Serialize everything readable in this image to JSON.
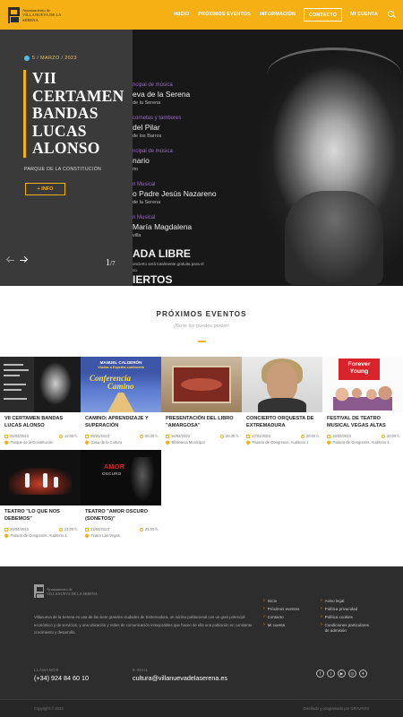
{
  "header": {
    "logo_line1": "Ayuntamiento de",
    "logo_line2": "VILLANUEVA DE LA SERENA",
    "nav": [
      "INICIO",
      "PRÓXIMOS EVENTOS",
      "INFORMACIÓN",
      "CONTACTO",
      "MI CUENTA"
    ],
    "accent": "#f5b014"
  },
  "hero": {
    "date": "5 / MARZO / 2023",
    "title": "VII CERTAMEN BANDAS LUCAS ALONSO",
    "place": "PARQUE DE LA CONSTITUCIÓN",
    "button": "+ INFO",
    "counter_current": "1",
    "counter_total": "/7",
    "poster_lines": [
      {
        "t": "ncipal de música",
        "s": "small"
      },
      {
        "t": "eva de la Serena",
        "s": "big"
      },
      {
        "t": "de la Serena",
        "s": "sub"
      },
      {
        "t": "",
        "s": "gap"
      },
      {
        "t": "cornetas y tambores",
        "s": "small"
      },
      {
        "t": "del Pilar",
        "s": "big"
      },
      {
        "t": "de los Barros",
        "s": "sub"
      },
      {
        "t": "",
        "s": "gap"
      },
      {
        "t": "ncipal de música",
        "s": "small"
      },
      {
        "t": "nario",
        "s": "big"
      },
      {
        "t": "rio",
        "s": "sub"
      },
      {
        "t": "",
        "s": "gap"
      },
      {
        "t": "n Musical",
        "s": "small"
      },
      {
        "t": "o Padre Jesús Nazareno",
        "s": "big"
      },
      {
        "t": "de la Serena",
        "s": "sub"
      },
      {
        "t": "",
        "s": "gap"
      },
      {
        "t": "n Musical",
        "s": "small"
      },
      {
        "t": "María Magdalena",
        "s": "big"
      },
      {
        "t": "villa",
        "s": "sub"
      },
      {
        "t": "",
        "s": "gap"
      },
      {
        "t": "ADA LIBRE",
        "s": "xl"
      },
      {
        "t": "oncierto será totalmente gratuita para el",
        "s": "tiny"
      },
      {
        "t": "co.",
        "s": "tiny"
      },
      {
        "t": "IERTOS",
        "s": "xl"
      },
      {
        "t": "s tendrán lugar en el Quiosco del Baile del",
        "s": "tiny"
      },
      {
        "t": "Constitución.",
        "s": "tiny"
      }
    ]
  },
  "events": {
    "title": "PRÓXIMOS EVENTOS",
    "subtitle": "¡No te los puedes perder!",
    "items": [
      {
        "title": "VII CERTAMEN BANDAS LUCAS ALONSO",
        "date": "05/03/2023",
        "time": "12:00 h.",
        "place": "Parque de la Constitución"
      },
      {
        "title": "CAMINO: APRENDIZAJE Y SUPERACIÓN",
        "date": "09/03/2023",
        "time": "20:30 h.",
        "place": "Casa de la Cultura"
      },
      {
        "title": "PRESENTACIÓN DEL LIBRO \"AMARGOSA\"",
        "date": "16/03/2023",
        "time": "20:30 h.",
        "place": "Biblioteca Municipal"
      },
      {
        "title": "CONCIERTO ORQUESTA DE EXTREMADURA",
        "date": "17/03/2023",
        "time": "20:00 h.",
        "place": "Palacio de Congresos. Auditorio 1"
      },
      {
        "title": "FESTIVAL DE TEATRO MUSICAL VEGAS ALTAS",
        "date": "18/03/2023",
        "time": "20:00 h.",
        "place": "Palacio de Congresos. Auditorio 1"
      },
      {
        "title": "TEATRO \"LO QUE NOS DEBEMOS\"",
        "date": "20/04/2023",
        "time": "21:00 h.",
        "place": "Palacio de Congresos. Auditorio 1"
      },
      {
        "title": "TEATRO \"AMOR OSCURO (SONETOS)\"",
        "date": "21/04/2023",
        "time": "21:00 h.",
        "place": "Teatro Las Vegas"
      }
    ],
    "thumb_texts": {
      "t2_line1": "MANUEL CALDERÓN",
      "t2_line2": "Viudas a Expedia continenta",
      "t2_word1": "Conferencia",
      "t2_word2": "Camino",
      "t5_line1": "Forever",
      "t5_line2": "Young",
      "t7_line1": "AMOR",
      "t7_line2": "OSCURO"
    }
  },
  "footer": {
    "logo_line1": "Ayuntamiento de",
    "logo_line2": "VILLANUEVA DE LA SERENA",
    "about": "Villanueva de la Serena es una de las siete grandes ciudades de Extremadura, un núcleo poblacional con un gran potencial económico y de servicios, y una ubicación y redes de comunicación inmejorables que hacen de ella una población en constante crecimiento y desarrollo.",
    "links_col1": [
      "Inicio",
      "Próximos eventos",
      "Contacto",
      "Mi cuenta"
    ],
    "links_col2": [
      "Aviso legal",
      "Política privacidad",
      "Política cookies",
      "Condiciones particulares de admisión"
    ],
    "phone_label": "LLÁMANOS",
    "phone": "(+34) 924 84 60 10",
    "email_label": "E-MAIL",
    "email": "cultura@villanuevadelaserena.es",
    "social": [
      "f",
      "t",
      "▶",
      "◎",
      "✈"
    ],
    "copyright": "Copyright © 2023",
    "credit": "Diseñado y programado por GRAVAVIS"
  }
}
